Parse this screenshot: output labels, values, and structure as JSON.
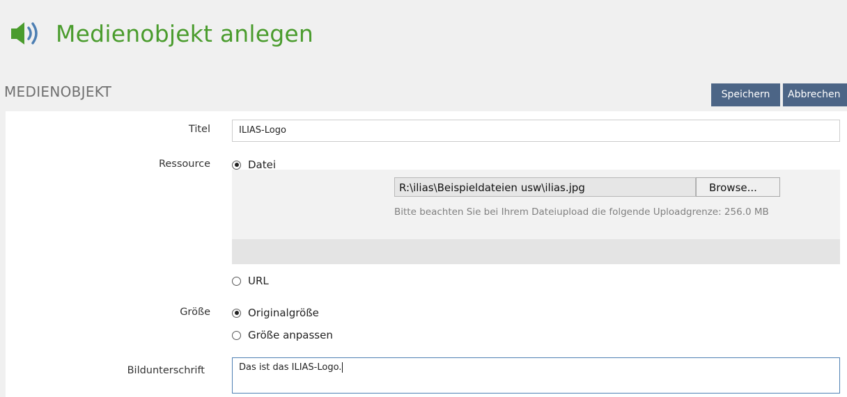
{
  "header": {
    "title": "Medienobjekt anlegen",
    "icon": "speaker-icon",
    "title_color": "#4a9c2d"
  },
  "section": {
    "title": "MEDIENOBJEKT"
  },
  "toolbar": {
    "save_label": "Speichern",
    "cancel_label": "Abbrechen",
    "button_color": "#4c6586"
  },
  "form": {
    "title_label": "Titel",
    "title_value": "ILIAS-Logo",
    "resource_label": "Ressource",
    "resource_options": [
      {
        "label": "Datei",
        "checked": true
      },
      {
        "label": "URL",
        "checked": false
      }
    ],
    "file_path": "R:\\ilias\\Beispieldateien usw\\ilias.jpg",
    "browse_label": "Browse...",
    "upload_note": "Bitte beachten Sie bei Ihrem Dateiupload die folgende Uploadgrenze: 256.0 MB",
    "size_label": "Größe",
    "size_options": [
      {
        "label": "Originalgröße",
        "checked": true
      },
      {
        "label": "Größe anpassen",
        "checked": false
      }
    ],
    "caption_label": "Bildunterschrift",
    "caption_value": "Das ist das ILIAS-Logo."
  }
}
